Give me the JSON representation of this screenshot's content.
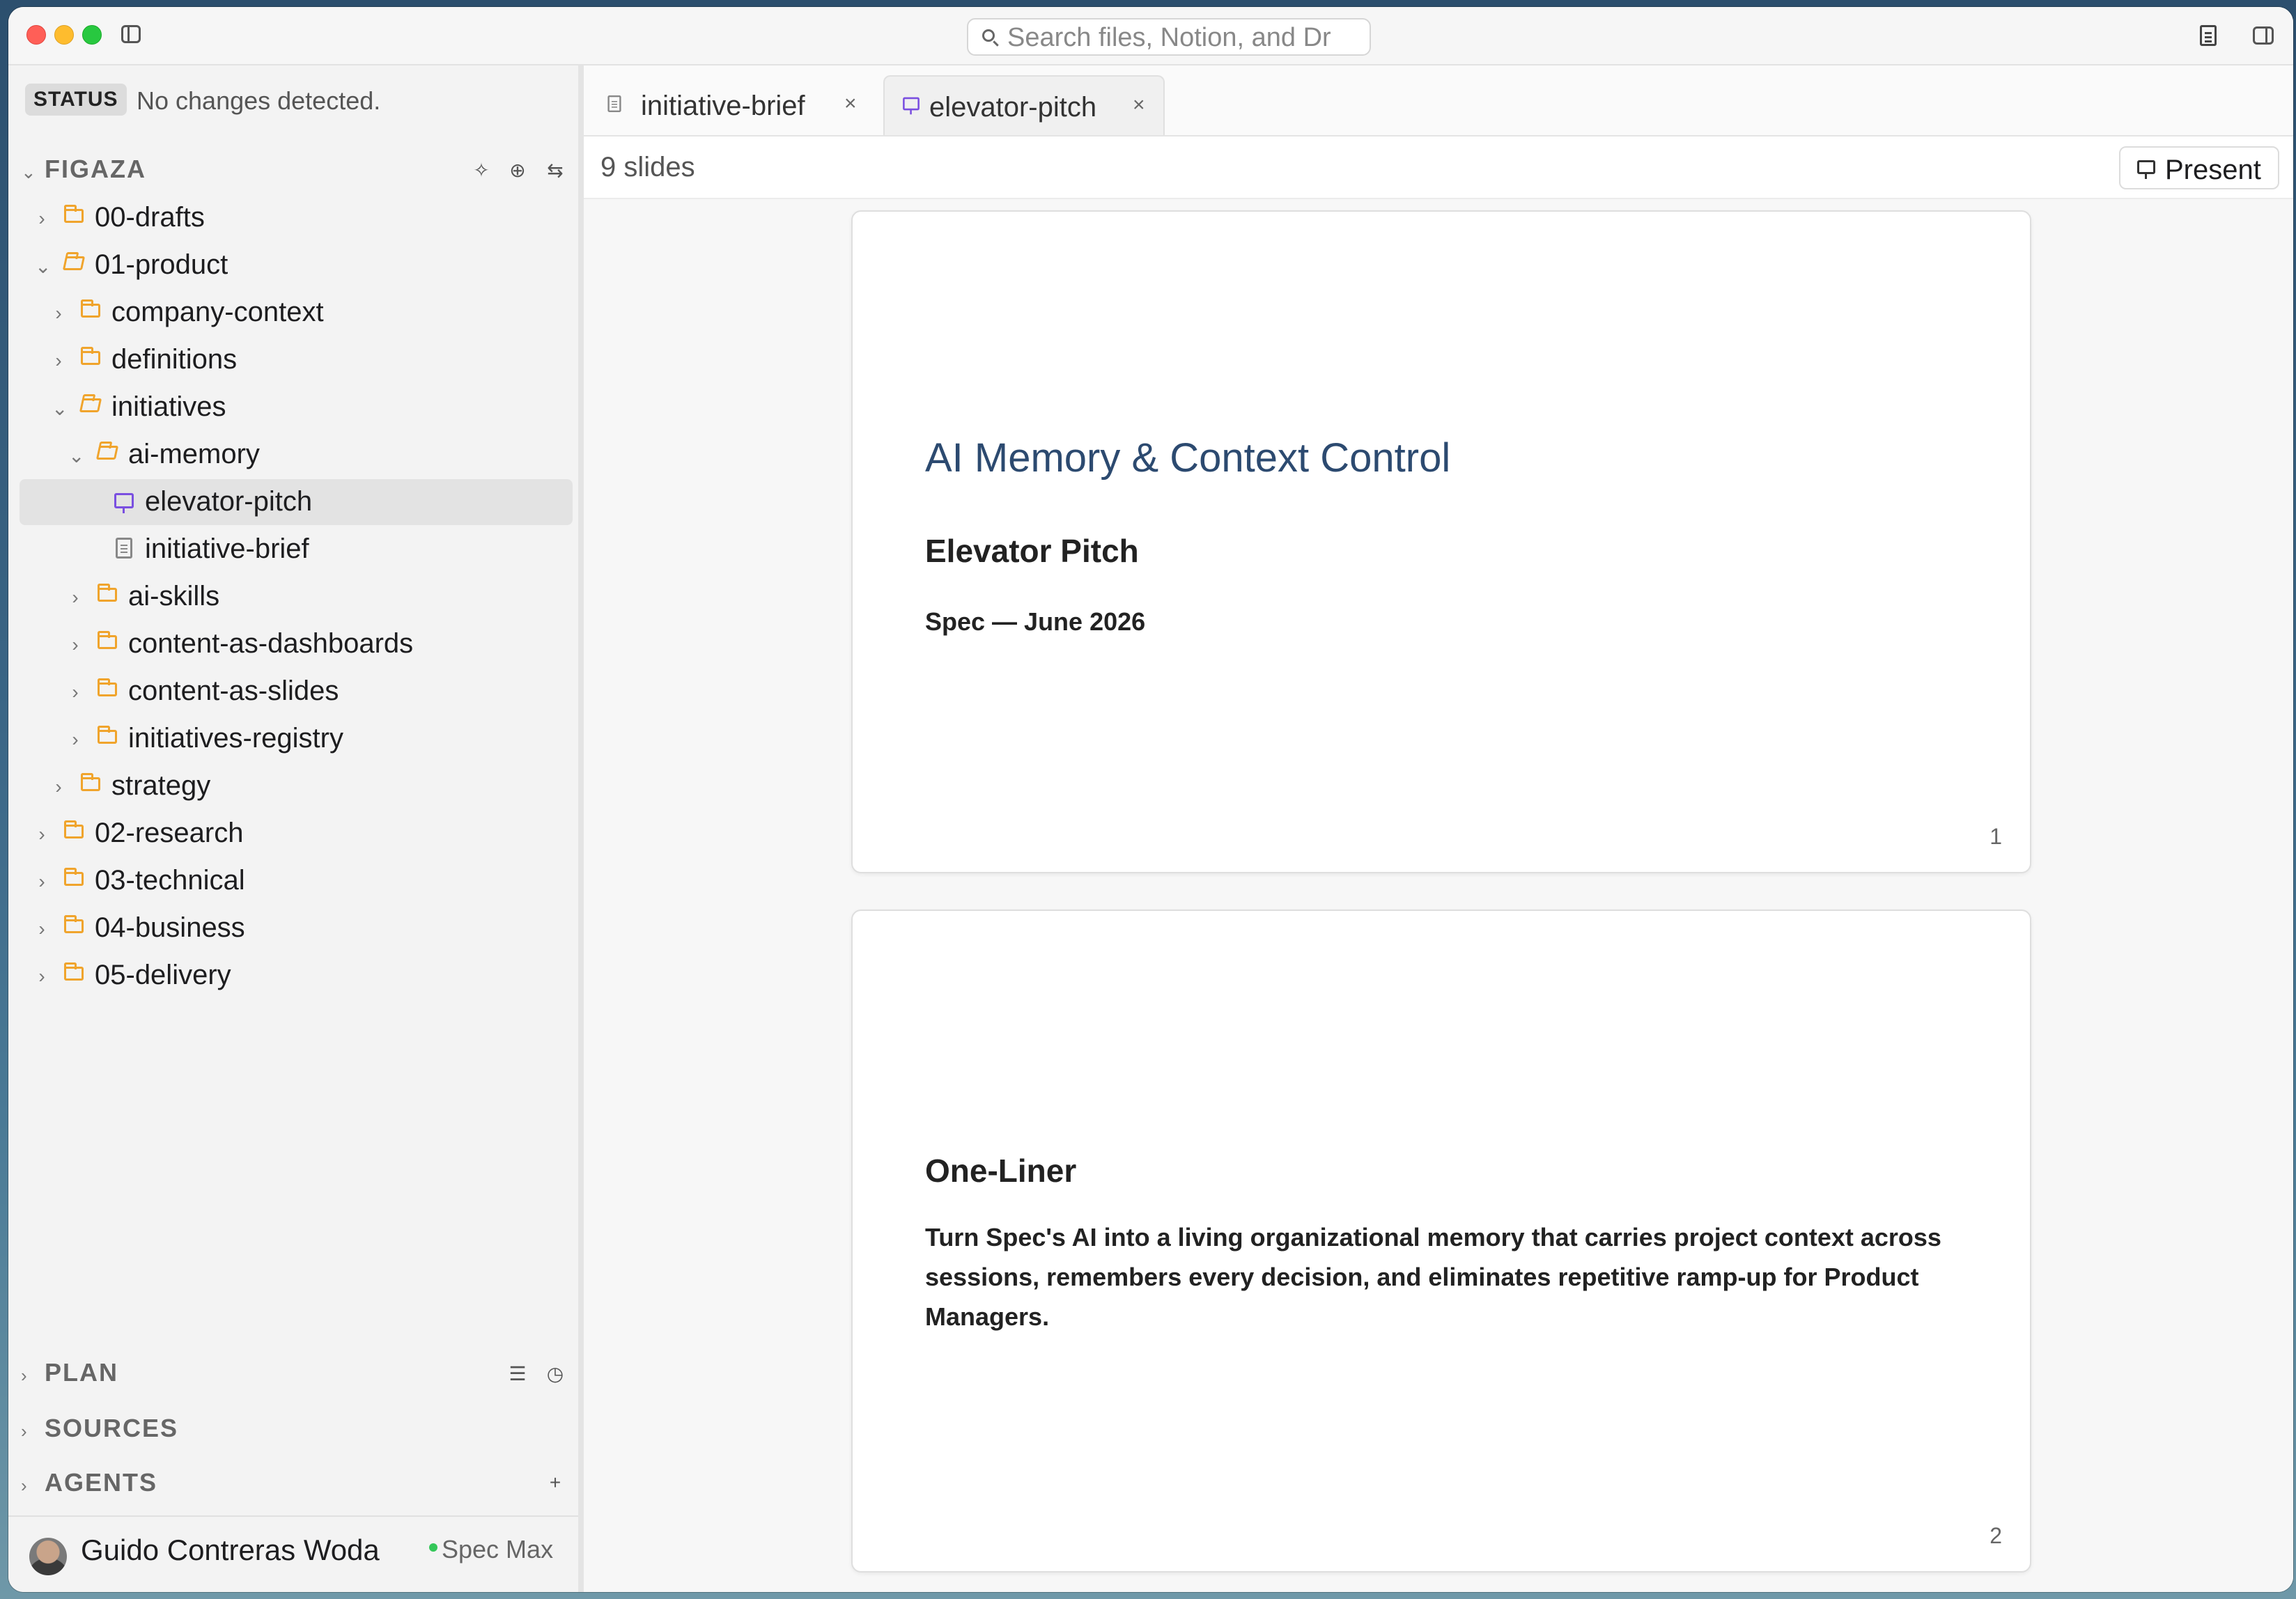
{
  "search": {
    "placeholder": "Search files, Notion, and Dr"
  },
  "status": {
    "badge": "STATUS",
    "text": "No changes detected."
  },
  "workspace": {
    "title": "FIGAZA"
  },
  "tree": [
    {
      "label": "00-drafts"
    },
    {
      "label": "01-product"
    },
    {
      "label": "company-context"
    },
    {
      "label": "definitions"
    },
    {
      "label": "initiatives"
    },
    {
      "label": "ai-memory"
    },
    {
      "label": "elevator-pitch"
    },
    {
      "label": "initiative-brief"
    },
    {
      "label": "ai-skills"
    },
    {
      "label": "content-as-dashboards"
    },
    {
      "label": "content-as-slides"
    },
    {
      "label": "initiatives-registry"
    },
    {
      "label": "strategy"
    },
    {
      "label": "02-research"
    },
    {
      "label": "03-technical"
    },
    {
      "label": "04-business"
    },
    {
      "label": "05-delivery"
    }
  ],
  "sections": {
    "plan": "PLAN",
    "sources": "SOURCES",
    "agents": "AGENTS"
  },
  "user": {
    "name": "Guido Contreras Woda",
    "plan": "Spec Max"
  },
  "tabs": [
    {
      "label": "initiative-brief"
    },
    {
      "label": "elevator-pitch"
    }
  ],
  "toolbar": {
    "slide_count": "9 slides",
    "present_label": "Present"
  },
  "slides": [
    {
      "title": "AI Memory & Context Control",
      "heading": "Elevator Pitch",
      "subtitle": "Spec — June 2026",
      "number": "1"
    },
    {
      "heading": "One-Liner",
      "body": "Turn Spec's AI into a living organizational memory that carries project context across sessions, remembers every decision, and eliminates repetitive ramp-up for Product Managers.",
      "number": "2"
    }
  ],
  "colors": {
    "folder": "#f0a42c",
    "slides_icon": "#7a4fe0",
    "slide_title": "#2c4a70",
    "online": "#34c759"
  },
  "icons": {
    "titlebar": [
      "sidebar-toggle-icon",
      "search-icon",
      "document-icon",
      "panel-toggle-icon"
    ],
    "workspace": [
      "sparkle-icon",
      "new-file-icon",
      "swap-icon"
    ],
    "plan": [
      "checklist-icon",
      "history-icon"
    ],
    "agents": [
      "plus-icon"
    ]
  }
}
